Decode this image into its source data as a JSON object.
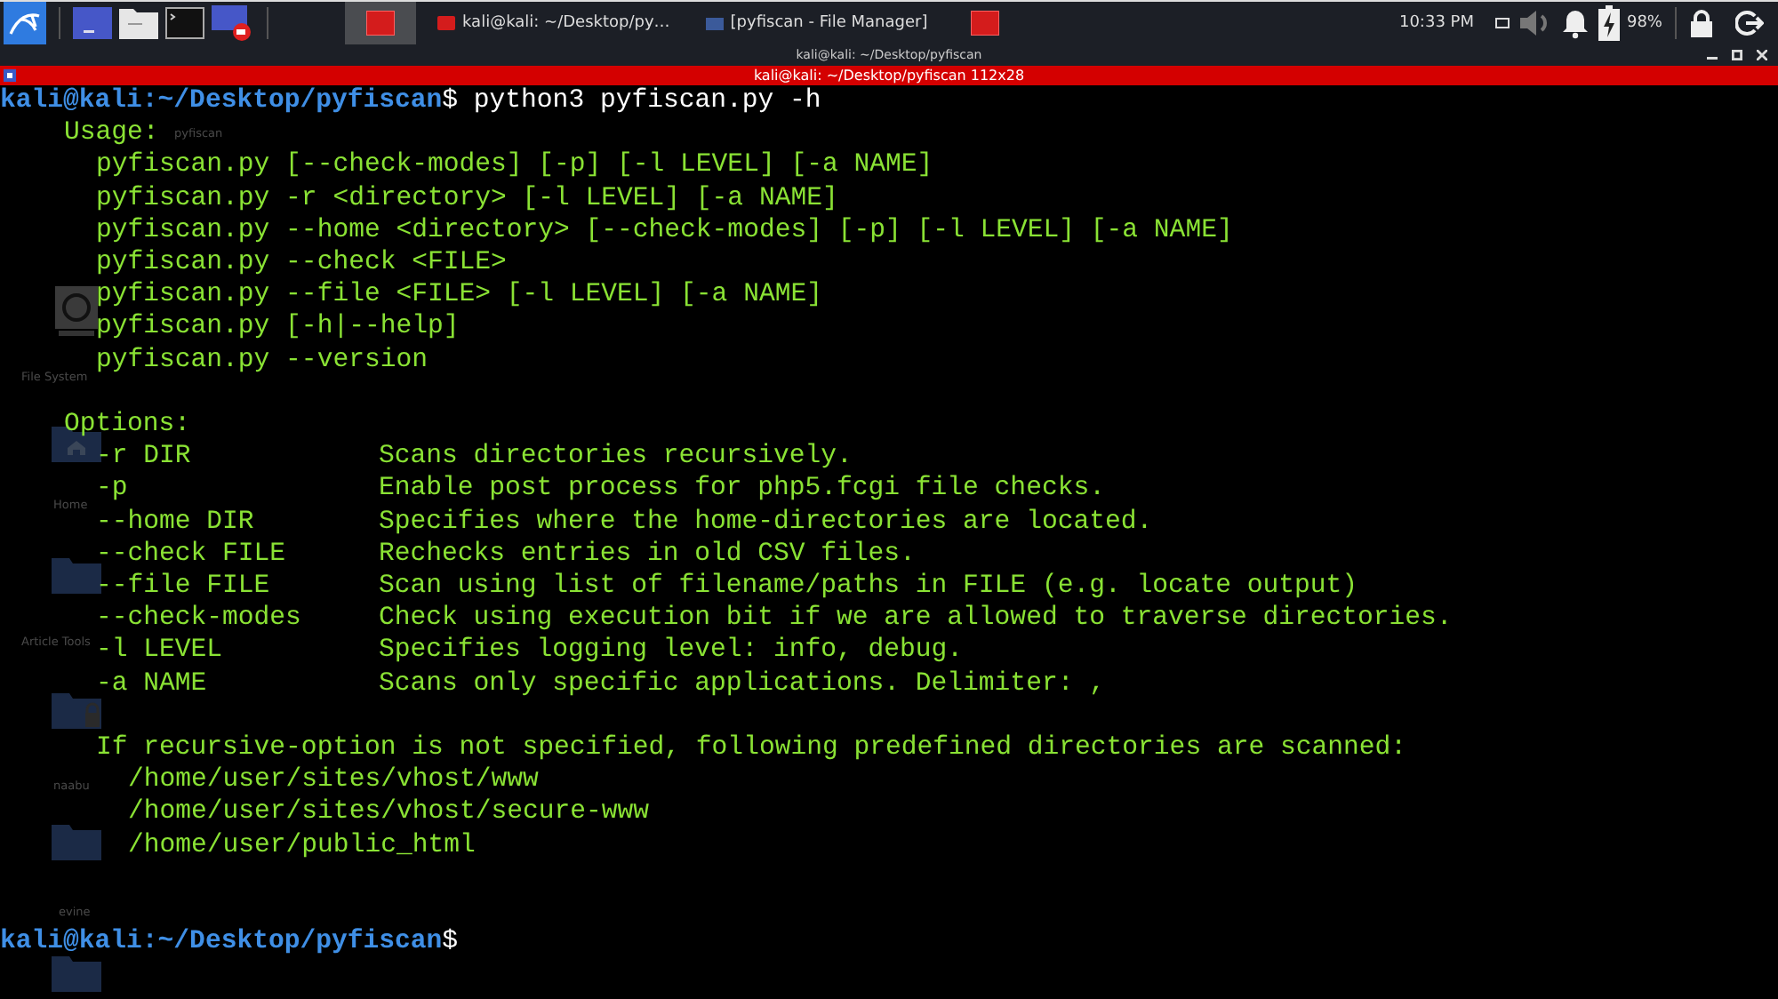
{
  "taskbar": {
    "tasks": [
      {
        "kind": "icon",
        "selected": true
      },
      {
        "kind": "labeled",
        "label": "kali@kali: ~/Desktop/py…",
        "selected": false
      },
      {
        "kind": "labeled",
        "label": "[pyfiscan - File Manager]",
        "selected": false
      },
      {
        "kind": "icon",
        "selected": false
      }
    ],
    "clock": "10:33 PM",
    "battery": "98%"
  },
  "window": {
    "title": "kali@kali: ~/Desktop/pyfiscan",
    "terminal_title": "kali@kali: ~/Desktop/pyfiscan 112x28"
  },
  "desktop_icons": [
    {
      "kind": "none",
      "label": "pyfiscan"
    },
    {
      "kind": "drive",
      "label": "File System"
    },
    {
      "kind": "home",
      "label": "Home"
    },
    {
      "kind": "folder",
      "label": "Article Tools"
    },
    {
      "kind": "locked",
      "label": "naabu"
    },
    {
      "kind": "folder",
      "label": "evine"
    },
    {
      "kind": "folder"
    }
  ],
  "terminal": {
    "prompt": {
      "user_host": "kali@kali",
      "path": ":~/Desktop/pyfiscan",
      "symbol": "$",
      "command": "python3 pyfiscan.py -h"
    },
    "usage_heading": "Usage:",
    "usage_lines": [
      "pyfiscan.py [--check-modes] [-p] [-l LEVEL] [-a NAME]",
      "pyfiscan.py -r <directory> [-l LEVEL] [-a NAME]",
      "pyfiscan.py --home <directory> [--check-modes] [-p] [-l LEVEL] [-a NAME]",
      "pyfiscan.py --check <FILE>",
      "pyfiscan.py --file <FILE> [-l LEVEL] [-a NAME]",
      "pyfiscan.py [-h|--help]",
      "pyfiscan.py --version"
    ],
    "options_heading": "Options:",
    "options": [
      {
        "flag": "-r DIR",
        "description": "Scans directories recursively."
      },
      {
        "flag": "-p",
        "description": "Enable post process for php5.fcgi file checks."
      },
      {
        "flag": "--home DIR",
        "description": "Specifies where the home-directories are located."
      },
      {
        "flag": "--check FILE",
        "description": "Rechecks entries in old CSV files."
      },
      {
        "flag": "--file FILE",
        "description": "Scan using list of filename/paths in FILE (e.g. locate output)"
      },
      {
        "flag": "--check-modes",
        "description": "Check using execution bit if we are allowed to traverse directories."
      },
      {
        "flag": "-l LEVEL",
        "description": "Specifies logging level: info, debug."
      },
      {
        "flag": "-a NAME",
        "description": "Scans only specific applications. Delimiter: ,"
      }
    ],
    "note": "If recursive-option is not specified, following predefined directories are scanned:",
    "directories": [
      "/home/user/sites/vhost/www",
      "/home/user/sites/vhost/secure-www",
      "/home/user/public_html"
    ],
    "final_prompt": {
      "user_host": "kali@kali",
      "path": ":~/Desktop/pyfiscan",
      "symbol": "$"
    }
  }
}
